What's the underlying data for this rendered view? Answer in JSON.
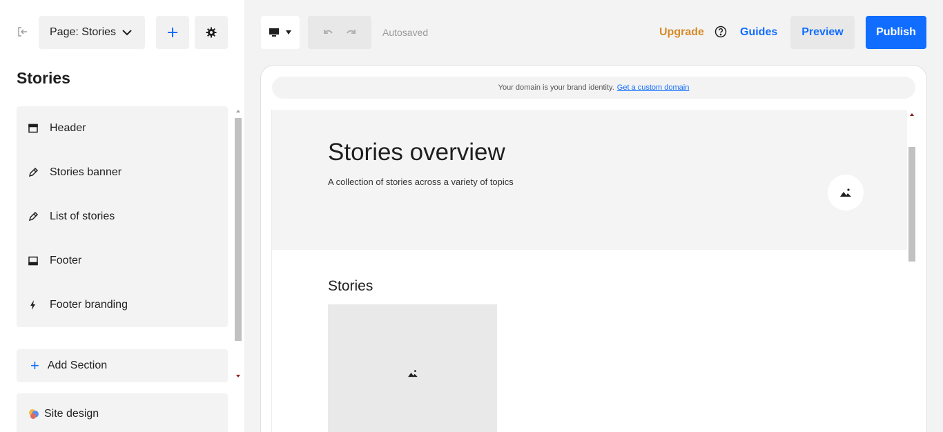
{
  "sidebar": {
    "page_select_label": "Page: Stories",
    "title": "Stories",
    "sections": [
      {
        "label": "Header",
        "icon": "header-icon"
      },
      {
        "label": "Stories banner",
        "icon": "pencil-icon"
      },
      {
        "label": "List of stories",
        "icon": "pencil-icon"
      },
      {
        "label": "Footer",
        "icon": "footer-icon"
      },
      {
        "label": "Footer branding",
        "icon": "bolt-icon"
      }
    ],
    "add_section_label": "Add Section",
    "site_design_label": "Site design"
  },
  "toolbar": {
    "autosaved": "Autosaved",
    "upgrade": "Upgrade",
    "guides": "Guides",
    "preview": "Preview",
    "publish": "Publish"
  },
  "canvas": {
    "domain_text": "Your domain is your brand identity.",
    "domain_link": "Get a custom domain",
    "hero_title": "Stories overview",
    "hero_subtitle": "A collection of stories across a variety of topics",
    "stories_heading": "Stories"
  },
  "colors": {
    "accent": "#116dff",
    "upgrade": "#d68b2a"
  }
}
